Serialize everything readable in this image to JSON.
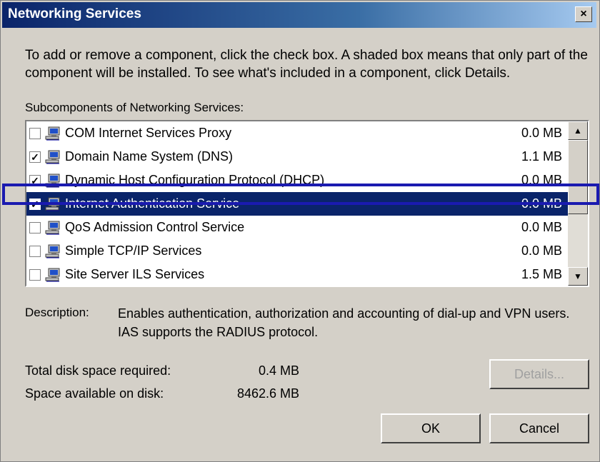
{
  "window": {
    "title": "Networking Services",
    "close_glyph": "×"
  },
  "intro_text": "To add or remove a component, click the check box. A shaded box means that only part of the component will be installed. To see what's included in a component, click Details.",
  "subcomponents_label": "Subcomponents of Networking Services:",
  "components": [
    {
      "label": "COM Internet Services Proxy",
      "size": "0.0 MB",
      "checked": false,
      "icon": "network-computer-icon"
    },
    {
      "label": "Domain Name System (DNS)",
      "size": "1.1 MB",
      "checked": true,
      "icon": "network-computer-icon"
    },
    {
      "label": "Dynamic Host Configuration Protocol (DHCP)",
      "size": "0.0 MB",
      "checked": true,
      "icon": "network-computer-icon"
    },
    {
      "label": "Internet Authentication Service",
      "size": "0.0 MB",
      "checked": true,
      "selected": true,
      "icon": "network-computer-icon"
    },
    {
      "label": "QoS Admission Control Service",
      "size": "0.0 MB",
      "checked": false,
      "icon": "network-computer-icon"
    },
    {
      "label": "Simple TCP/IP Services",
      "size": "0.0 MB",
      "checked": false,
      "icon": "network-computer-icon"
    },
    {
      "label": "Site Server ILS Services",
      "size": "1.5 MB",
      "checked": false,
      "icon": "network-computer-icon"
    }
  ],
  "description": {
    "label": "Description:",
    "text": "Enables authentication, authorization and accounting of dial-up and VPN users. IAS supports the RADIUS protocol."
  },
  "disk": {
    "required_label": "Total disk space required:",
    "required_value": "0.4 MB",
    "available_label": "Space available on disk:",
    "available_value": "8462.6 MB"
  },
  "buttons": {
    "details": "Details...",
    "ok": "OK",
    "cancel": "Cancel"
  },
  "colors": {
    "selection": "#0a246a",
    "annotation_box": "#1a1ab0",
    "face": "#d4d0c8"
  }
}
